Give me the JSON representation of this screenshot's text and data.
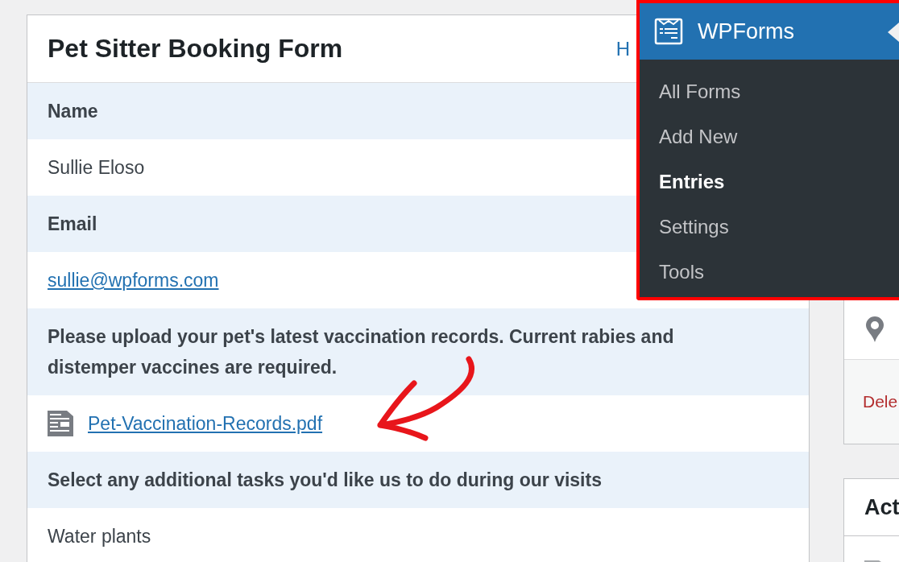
{
  "entry": {
    "title": "Pet Sitter Booking Form",
    "header_link": "H",
    "fields": [
      {
        "label": "Name",
        "kind": "text",
        "value": "Sullie Eloso"
      },
      {
        "label": "Email",
        "kind": "link",
        "value": "sullie@wpforms.com"
      },
      {
        "label": "Please upload your pet's latest vaccination records. Current rabies and distemper vaccines are required.",
        "kind": "file",
        "value": "Pet-Vaccination-Records.pdf"
      },
      {
        "label": "Select any additional tasks you'd like us to do during our visits",
        "kind": "text",
        "value": "Water plants"
      }
    ]
  },
  "side": {
    "delete_link": "Dele",
    "actions_title": "Act"
  },
  "menu": {
    "title": "WPForms",
    "items": [
      {
        "label": "All Forms",
        "selected": false
      },
      {
        "label": "Add New",
        "selected": false
      },
      {
        "label": "Entries",
        "selected": true
      },
      {
        "label": "Settings",
        "selected": false
      },
      {
        "label": "Tools",
        "selected": false
      }
    ]
  }
}
